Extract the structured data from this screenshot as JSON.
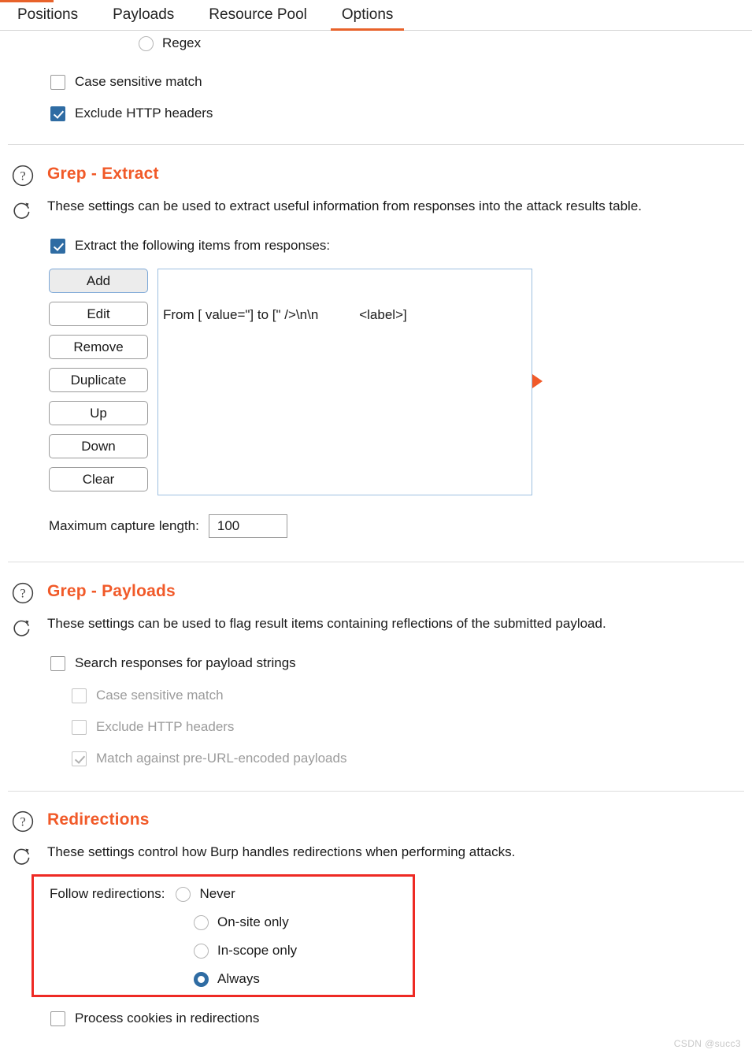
{
  "tabs": [
    {
      "label": "Positions",
      "active": false
    },
    {
      "label": "Payloads",
      "active": false
    },
    {
      "label": "Resource Pool",
      "active": false
    },
    {
      "label": "Options",
      "active": true
    }
  ],
  "colors": {
    "accent_orange": "#f15a29",
    "tab_underline": "#e8622a",
    "checkbox_blue": "#2f6ca3",
    "radio_blue": "#2f6ca3",
    "highlight_red": "#ee2a24",
    "focus_border": "#7ba7d7"
  },
  "grep_match_tail": {
    "regex_radio_label": "Regex",
    "case_sensitive_label": "Case sensitive match",
    "case_sensitive_checked": false,
    "exclude_headers_label": "Exclude HTTP headers",
    "exclude_headers_checked": true
  },
  "grep_extract": {
    "help_icon": "help-circle-icon",
    "reset_icon": "reset-circular-arrow-icon",
    "title": "Grep - Extract",
    "description": "These settings can be used to extract useful information from responses into the attack results table.",
    "enable_label": "Extract the following items from responses:",
    "enable_checked": true,
    "buttons": [
      {
        "label": "Add",
        "focused": true
      },
      {
        "label": "Edit",
        "focused": false
      },
      {
        "label": "Remove",
        "focused": false
      },
      {
        "label": "Duplicate",
        "focused": false
      },
      {
        "label": "Up",
        "focused": false
      },
      {
        "label": "Down",
        "focused": false
      },
      {
        "label": "Clear",
        "focused": false
      }
    ],
    "items": [
      "From [ value=\"] to [\" />\\n\\n           <label>]"
    ],
    "pointer_icon": "orange-triangle-right-icon",
    "max_capture_label": "Maximum capture length:",
    "max_capture_value": "100"
  },
  "grep_payloads": {
    "help_icon": "help-circle-icon",
    "reset_icon": "reset-circular-arrow-icon",
    "title": "Grep - Payloads",
    "description": "These settings can be used to flag result items containing reflections of the submitted payload.",
    "options": [
      {
        "label": "Search responses for payload strings",
        "checked": false,
        "disabled": false,
        "indent": 0
      },
      {
        "label": "Case sensitive match",
        "checked": false,
        "disabled": true,
        "indent": 1
      },
      {
        "label": "Exclude HTTP headers",
        "checked": false,
        "disabled": true,
        "indent": 1
      },
      {
        "label": "Match against pre-URL-encoded payloads",
        "checked": true,
        "disabled": true,
        "indent": 1
      }
    ]
  },
  "redirections": {
    "help_icon": "help-circle-icon",
    "reset_icon": "reset-circular-arrow-icon",
    "title": "Redirections",
    "description": "These settings control how Burp handles redirections when performing attacks.",
    "follow_label": "Follow redirections:",
    "radios": [
      {
        "label": "Never",
        "selected": false
      },
      {
        "label": "On-site only",
        "selected": false
      },
      {
        "label": "In-scope only",
        "selected": false
      },
      {
        "label": "Always",
        "selected": true
      }
    ],
    "process_cookies_label": "Process cookies in redirections",
    "process_cookies_checked": false
  },
  "watermark": "CSDN @succ3"
}
